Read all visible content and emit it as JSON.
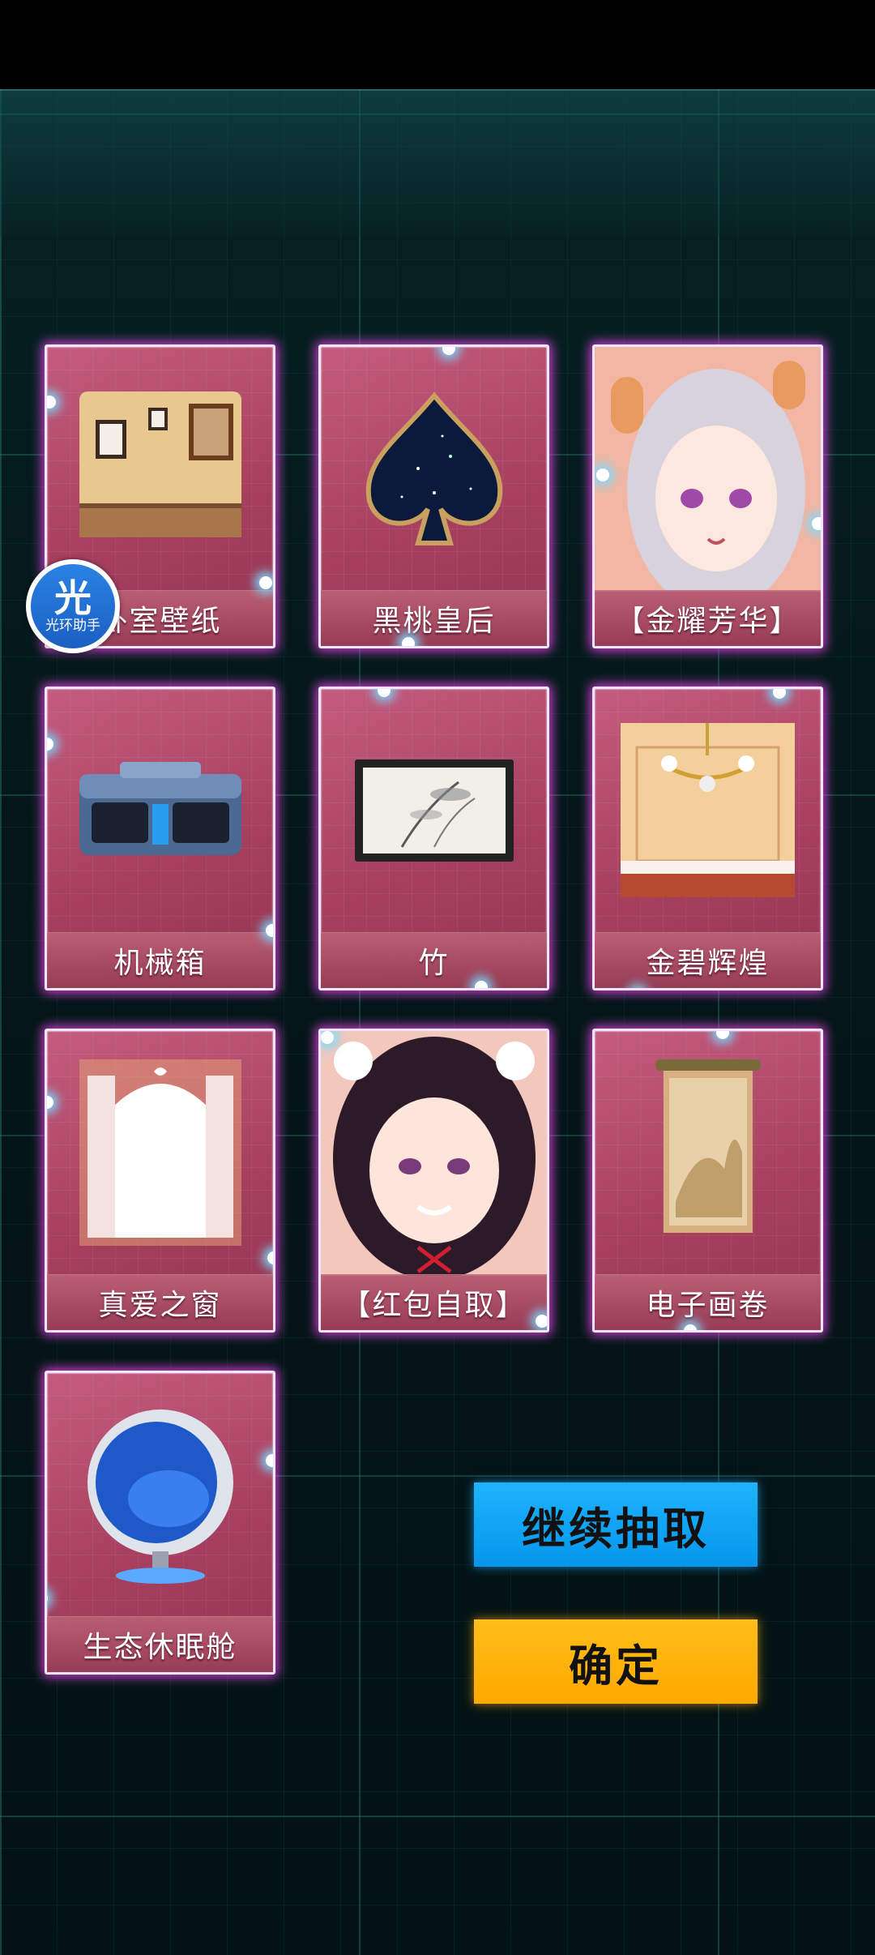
{
  "cards": [
    {
      "label": "卧室壁纸",
      "art": "wallpaper-icon"
    },
    {
      "label": "黑桃皇后",
      "art": "spade-icon"
    },
    {
      "label": "【金耀芳华】",
      "art": "character-portrait"
    },
    {
      "label": "机械箱",
      "art": "mech-box-icon"
    },
    {
      "label": "竹",
      "art": "bamboo-painting-icon"
    },
    {
      "label": "金碧辉煌",
      "art": "chandelier-icon"
    },
    {
      "label": "真爱之窗",
      "art": "window-icon"
    },
    {
      "label": "【红包自取】",
      "art": "character-portrait"
    },
    {
      "label": "电子画卷",
      "art": "scroll-painting-icon"
    },
    {
      "label": "生态休眠舱",
      "art": "egg-chair-icon"
    }
  ],
  "buttons": {
    "continue_label": "继续抽取",
    "confirm_label": "确定"
  },
  "badge": {
    "glyph": "光",
    "text": "光环助手"
  },
  "colors": {
    "continue_button": "#0596ea",
    "confirm_button": "#ffa800",
    "card_base": "#a8405f",
    "glow": "#f046f0"
  }
}
